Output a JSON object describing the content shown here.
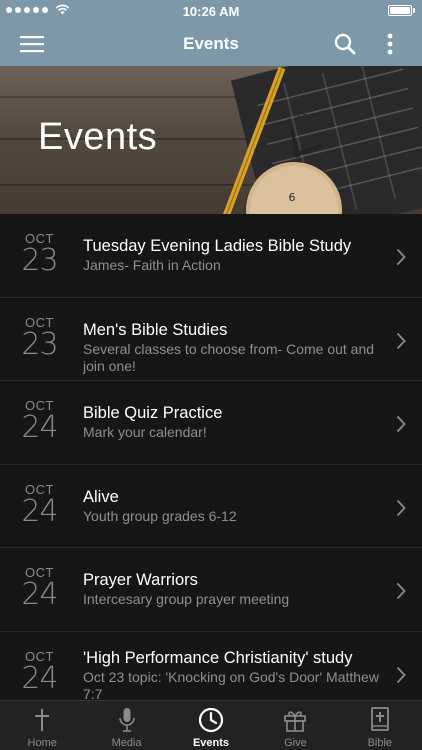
{
  "status": {
    "time": "10:26 AM"
  },
  "nav": {
    "title": "Events"
  },
  "hero": {
    "title": "Events"
  },
  "events": [
    {
      "month": "OCT",
      "day": "23",
      "title": "Tuesday Evening Ladies Bible Study",
      "subtitle": "James- Faith in Action"
    },
    {
      "month": "OCT",
      "day": "23",
      "title": "Men's Bible Studies",
      "subtitle": "Several classes to choose from- Come out and join one!"
    },
    {
      "month": "OCT",
      "day": "24",
      "title": "Bible Quiz Practice",
      "subtitle": "Mark your calendar!"
    },
    {
      "month": "OCT",
      "day": "24",
      "title": "Alive",
      "subtitle": "Youth group grades 6-12"
    },
    {
      "month": "OCT",
      "day": "24",
      "title": "Prayer Warriors",
      "subtitle": "Intercesary group prayer meeting"
    },
    {
      "month": "OCT",
      "day": "24",
      "title": "'High Performance Christianity' study",
      "subtitle": "Oct 23 topic: 'Knocking on God's Door' Matthew 7:7"
    }
  ],
  "tabs": [
    {
      "label": "Home",
      "icon": "cross-icon",
      "active": false
    },
    {
      "label": "Media",
      "icon": "microphone-icon",
      "active": false
    },
    {
      "label": "Events",
      "icon": "clock-icon",
      "active": true
    },
    {
      "label": "Give",
      "icon": "gift-icon",
      "active": false
    },
    {
      "label": "Bible",
      "icon": "bible-icon",
      "active": false
    }
  ],
  "colors": {
    "nav_bg": "#7c98a9",
    "list_bg": "#161616",
    "tab_bar_bg": "#222222"
  }
}
